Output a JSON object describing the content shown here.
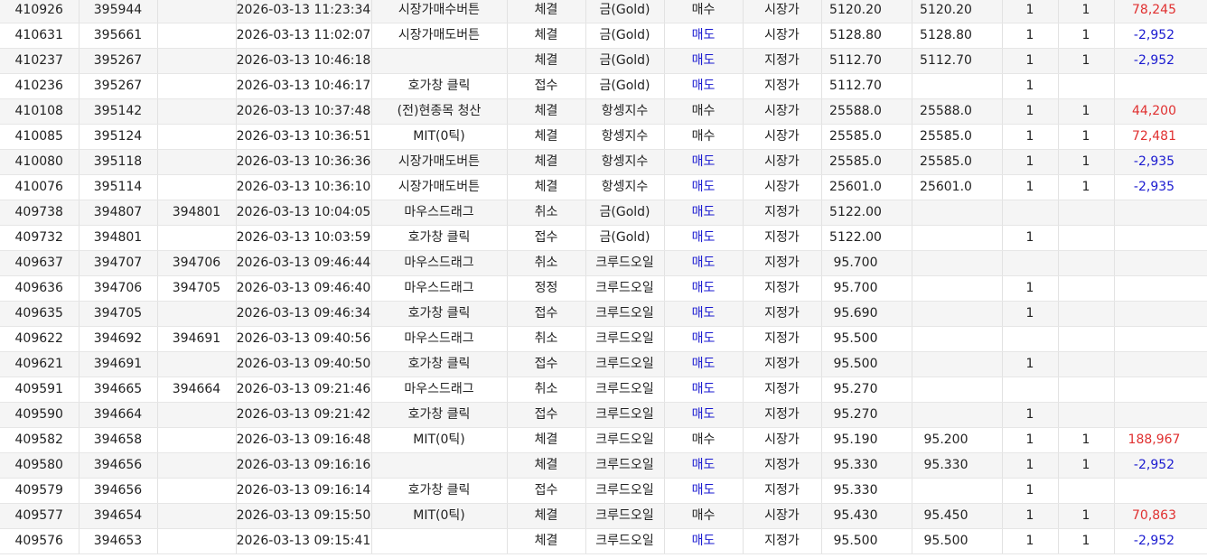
{
  "colors": {
    "sell": "#1a1ad0",
    "profit": "#e03030",
    "loss": "#1a1ad0",
    "row_alt": "#f5f5f5",
    "grid_line": "#e2e2e2"
  },
  "rows": [
    {
      "no": "410926",
      "order_no": "395944",
      "orig_no": "",
      "time": "2026-03-13 11:23:34",
      "method": "시장가매수버튼",
      "status": "체결",
      "product": "금(Gold)",
      "side": "매수",
      "side_type": "buy",
      "price_type": "시장가",
      "order_price": "5120.20",
      "fill_price": "5120.20",
      "order_qty": "1",
      "fill_qty": "1",
      "pnl": "78,245",
      "pnl_sign": "pos"
    },
    {
      "no": "410631",
      "order_no": "395661",
      "orig_no": "",
      "time": "2026-03-13 11:02:07",
      "method": "시장가매도버튼",
      "status": "체결",
      "product": "금(Gold)",
      "side": "매도",
      "side_type": "sell",
      "price_type": "시장가",
      "order_price": "5128.80",
      "fill_price": "5128.80",
      "order_qty": "1",
      "fill_qty": "1",
      "pnl": "-2,952",
      "pnl_sign": "neg"
    },
    {
      "no": "410237",
      "order_no": "395267",
      "orig_no": "",
      "time": "2026-03-13 10:46:18",
      "method": "",
      "status": "체결",
      "product": "금(Gold)",
      "side": "매도",
      "side_type": "sell",
      "price_type": "지정가",
      "order_price": "5112.70",
      "fill_price": "5112.70",
      "order_qty": "1",
      "fill_qty": "1",
      "pnl": "-2,952",
      "pnl_sign": "neg"
    },
    {
      "no": "410236",
      "order_no": "395267",
      "orig_no": "",
      "time": "2026-03-13 10:46:17",
      "method": "호가창 클릭",
      "status": "접수",
      "product": "금(Gold)",
      "side": "매도",
      "side_type": "sell",
      "price_type": "지정가",
      "order_price": "5112.70",
      "fill_price": "",
      "order_qty": "1",
      "fill_qty": "",
      "pnl": "",
      "pnl_sign": ""
    },
    {
      "no": "410108",
      "order_no": "395142",
      "orig_no": "",
      "time": "2026-03-13 10:37:48",
      "method": "(전)현종목 청산",
      "status": "체결",
      "product": "항셍지수",
      "side": "매수",
      "side_type": "buy",
      "price_type": "시장가",
      "order_price": "25588.0",
      "fill_price": "25588.0",
      "order_qty": "1",
      "fill_qty": "1",
      "pnl": "44,200",
      "pnl_sign": "pos"
    },
    {
      "no": "410085",
      "order_no": "395124",
      "orig_no": "",
      "time": "2026-03-13 10:36:51",
      "method": "MIT(0틱)",
      "status": "체결",
      "product": "항셍지수",
      "side": "매수",
      "side_type": "buy",
      "price_type": "시장가",
      "order_price": "25585.0",
      "fill_price": "25585.0",
      "order_qty": "1",
      "fill_qty": "1",
      "pnl": "72,481",
      "pnl_sign": "pos"
    },
    {
      "no": "410080",
      "order_no": "395118",
      "orig_no": "",
      "time": "2026-03-13 10:36:36",
      "method": "시장가매도버튼",
      "status": "체결",
      "product": "항셍지수",
      "side": "매도",
      "side_type": "sell",
      "price_type": "시장가",
      "order_price": "25585.0",
      "fill_price": "25585.0",
      "order_qty": "1",
      "fill_qty": "1",
      "pnl": "-2,935",
      "pnl_sign": "neg"
    },
    {
      "no": "410076",
      "order_no": "395114",
      "orig_no": "",
      "time": "2026-03-13 10:36:10",
      "method": "시장가매도버튼",
      "status": "체결",
      "product": "항셍지수",
      "side": "매도",
      "side_type": "sell",
      "price_type": "시장가",
      "order_price": "25601.0",
      "fill_price": "25601.0",
      "order_qty": "1",
      "fill_qty": "1",
      "pnl": "-2,935",
      "pnl_sign": "neg"
    },
    {
      "no": "409738",
      "order_no": "394807",
      "orig_no": "394801",
      "time": "2026-03-13 10:04:05",
      "method": "마우스드래그",
      "status": "취소",
      "product": "금(Gold)",
      "side": "매도",
      "side_type": "sell",
      "price_type": "지정가",
      "order_price": "5122.00",
      "fill_price": "",
      "order_qty": "",
      "fill_qty": "",
      "pnl": "",
      "pnl_sign": ""
    },
    {
      "no": "409732",
      "order_no": "394801",
      "orig_no": "",
      "time": "2026-03-13 10:03:59",
      "method": "호가창 클릭",
      "status": "접수",
      "product": "금(Gold)",
      "side": "매도",
      "side_type": "sell",
      "price_type": "지정가",
      "order_price": "5122.00",
      "fill_price": "",
      "order_qty": "1",
      "fill_qty": "",
      "pnl": "",
      "pnl_sign": ""
    },
    {
      "no": "409637",
      "order_no": "394707",
      "orig_no": "394706",
      "time": "2026-03-13 09:46:44",
      "method": "마우스드래그",
      "status": "취소",
      "product": "크루드오일",
      "side": "매도",
      "side_type": "sell",
      "price_type": "지정가",
      "order_price": "95.700",
      "fill_price": "",
      "order_qty": "",
      "fill_qty": "",
      "pnl": "",
      "pnl_sign": ""
    },
    {
      "no": "409636",
      "order_no": "394706",
      "orig_no": "394705",
      "time": "2026-03-13 09:46:40",
      "method": "마우스드래그",
      "status": "정정",
      "product": "크루드오일",
      "side": "매도",
      "side_type": "sell",
      "price_type": "지정가",
      "order_price": "95.700",
      "fill_price": "",
      "order_qty": "1",
      "fill_qty": "",
      "pnl": "",
      "pnl_sign": ""
    },
    {
      "no": "409635",
      "order_no": "394705",
      "orig_no": "",
      "time": "2026-03-13 09:46:34",
      "method": "호가창 클릭",
      "status": "접수",
      "product": "크루드오일",
      "side": "매도",
      "side_type": "sell",
      "price_type": "지정가",
      "order_price": "95.690",
      "fill_price": "",
      "order_qty": "1",
      "fill_qty": "",
      "pnl": "",
      "pnl_sign": ""
    },
    {
      "no": "409622",
      "order_no": "394692",
      "orig_no": "394691",
      "time": "2026-03-13 09:40:56",
      "method": "마우스드래그",
      "status": "취소",
      "product": "크루드오일",
      "side": "매도",
      "side_type": "sell",
      "price_type": "지정가",
      "order_price": "95.500",
      "fill_price": "",
      "order_qty": "",
      "fill_qty": "",
      "pnl": "",
      "pnl_sign": ""
    },
    {
      "no": "409621",
      "order_no": "394691",
      "orig_no": "",
      "time": "2026-03-13 09:40:50",
      "method": "호가창 클릭",
      "status": "접수",
      "product": "크루드오일",
      "side": "매도",
      "side_type": "sell",
      "price_type": "지정가",
      "order_price": "95.500",
      "fill_price": "",
      "order_qty": "1",
      "fill_qty": "",
      "pnl": "",
      "pnl_sign": ""
    },
    {
      "no": "409591",
      "order_no": "394665",
      "orig_no": "394664",
      "time": "2026-03-13 09:21:46",
      "method": "마우스드래그",
      "status": "취소",
      "product": "크루드오일",
      "side": "매도",
      "side_type": "sell",
      "price_type": "지정가",
      "order_price": "95.270",
      "fill_price": "",
      "order_qty": "",
      "fill_qty": "",
      "pnl": "",
      "pnl_sign": ""
    },
    {
      "no": "409590",
      "order_no": "394664",
      "orig_no": "",
      "time": "2026-03-13 09:21:42",
      "method": "호가창 클릭",
      "status": "접수",
      "product": "크루드오일",
      "side": "매도",
      "side_type": "sell",
      "price_type": "지정가",
      "order_price": "95.270",
      "fill_price": "",
      "order_qty": "1",
      "fill_qty": "",
      "pnl": "",
      "pnl_sign": ""
    },
    {
      "no": "409582",
      "order_no": "394658",
      "orig_no": "",
      "time": "2026-03-13 09:16:48",
      "method": "MIT(0틱)",
      "status": "체결",
      "product": "크루드오일",
      "side": "매수",
      "side_type": "buy",
      "price_type": "시장가",
      "order_price": "95.190",
      "fill_price": "95.200",
      "order_qty": "1",
      "fill_qty": "1",
      "pnl": "188,967",
      "pnl_sign": "pos"
    },
    {
      "no": "409580",
      "order_no": "394656",
      "orig_no": "",
      "time": "2026-03-13 09:16:16",
      "method": "",
      "status": "체결",
      "product": "크루드오일",
      "side": "매도",
      "side_type": "sell",
      "price_type": "지정가",
      "order_price": "95.330",
      "fill_price": "95.330",
      "order_qty": "1",
      "fill_qty": "1",
      "pnl": "-2,952",
      "pnl_sign": "neg"
    },
    {
      "no": "409579",
      "order_no": "394656",
      "orig_no": "",
      "time": "2026-03-13 09:16:14",
      "method": "호가창 클릭",
      "status": "접수",
      "product": "크루드오일",
      "side": "매도",
      "side_type": "sell",
      "price_type": "지정가",
      "order_price": "95.330",
      "fill_price": "",
      "order_qty": "1",
      "fill_qty": "",
      "pnl": "",
      "pnl_sign": ""
    },
    {
      "no": "409577",
      "order_no": "394654",
      "orig_no": "",
      "time": "2026-03-13 09:15:50",
      "method": "MIT(0틱)",
      "status": "체결",
      "product": "크루드오일",
      "side": "매수",
      "side_type": "buy",
      "price_type": "시장가",
      "order_price": "95.430",
      "fill_price": "95.450",
      "order_qty": "1",
      "fill_qty": "1",
      "pnl": "70,863",
      "pnl_sign": "pos"
    },
    {
      "no": "409576",
      "order_no": "394653",
      "orig_no": "",
      "time": "2026-03-13 09:15:41",
      "method": "",
      "status": "체결",
      "product": "크루드오일",
      "side": "매도",
      "side_type": "sell",
      "price_type": "지정가",
      "order_price": "95.500",
      "fill_price": "95.500",
      "order_qty": "1",
      "fill_qty": "1",
      "pnl": "-2,952",
      "pnl_sign": "neg"
    }
  ]
}
